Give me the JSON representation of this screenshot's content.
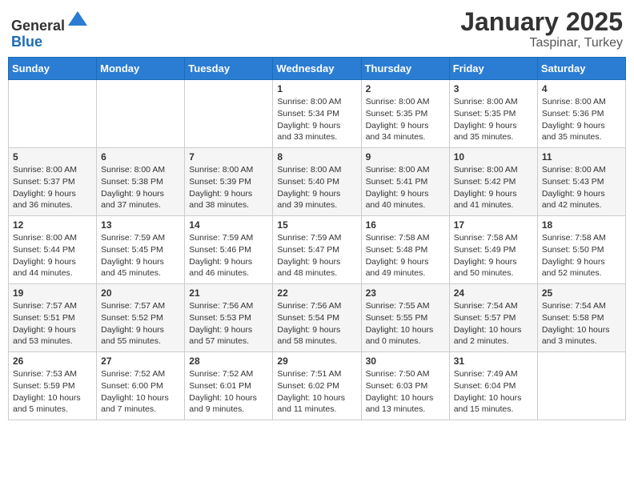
{
  "header": {
    "logo_general": "General",
    "logo_blue": "Blue",
    "month_title": "January 2025",
    "location": "Taspinar, Turkey"
  },
  "days_of_week": [
    "Sunday",
    "Monday",
    "Tuesday",
    "Wednesday",
    "Thursday",
    "Friday",
    "Saturday"
  ],
  "weeks": [
    [
      {
        "day": "",
        "info": ""
      },
      {
        "day": "",
        "info": ""
      },
      {
        "day": "",
        "info": ""
      },
      {
        "day": "1",
        "info": "Sunrise: 8:00 AM\nSunset: 5:34 PM\nDaylight: 9 hours\nand 33 minutes."
      },
      {
        "day": "2",
        "info": "Sunrise: 8:00 AM\nSunset: 5:35 PM\nDaylight: 9 hours\nand 34 minutes."
      },
      {
        "day": "3",
        "info": "Sunrise: 8:00 AM\nSunset: 5:35 PM\nDaylight: 9 hours\nand 35 minutes."
      },
      {
        "day": "4",
        "info": "Sunrise: 8:00 AM\nSunset: 5:36 PM\nDaylight: 9 hours\nand 35 minutes."
      }
    ],
    [
      {
        "day": "5",
        "info": "Sunrise: 8:00 AM\nSunset: 5:37 PM\nDaylight: 9 hours\nand 36 minutes."
      },
      {
        "day": "6",
        "info": "Sunrise: 8:00 AM\nSunset: 5:38 PM\nDaylight: 9 hours\nand 37 minutes."
      },
      {
        "day": "7",
        "info": "Sunrise: 8:00 AM\nSunset: 5:39 PM\nDaylight: 9 hours\nand 38 minutes."
      },
      {
        "day": "8",
        "info": "Sunrise: 8:00 AM\nSunset: 5:40 PM\nDaylight: 9 hours\nand 39 minutes."
      },
      {
        "day": "9",
        "info": "Sunrise: 8:00 AM\nSunset: 5:41 PM\nDaylight: 9 hours\nand 40 minutes."
      },
      {
        "day": "10",
        "info": "Sunrise: 8:00 AM\nSunset: 5:42 PM\nDaylight: 9 hours\nand 41 minutes."
      },
      {
        "day": "11",
        "info": "Sunrise: 8:00 AM\nSunset: 5:43 PM\nDaylight: 9 hours\nand 42 minutes."
      }
    ],
    [
      {
        "day": "12",
        "info": "Sunrise: 8:00 AM\nSunset: 5:44 PM\nDaylight: 9 hours\nand 44 minutes."
      },
      {
        "day": "13",
        "info": "Sunrise: 7:59 AM\nSunset: 5:45 PM\nDaylight: 9 hours\nand 45 minutes."
      },
      {
        "day": "14",
        "info": "Sunrise: 7:59 AM\nSunset: 5:46 PM\nDaylight: 9 hours\nand 46 minutes."
      },
      {
        "day": "15",
        "info": "Sunrise: 7:59 AM\nSunset: 5:47 PM\nDaylight: 9 hours\nand 48 minutes."
      },
      {
        "day": "16",
        "info": "Sunrise: 7:58 AM\nSunset: 5:48 PM\nDaylight: 9 hours\nand 49 minutes."
      },
      {
        "day": "17",
        "info": "Sunrise: 7:58 AM\nSunset: 5:49 PM\nDaylight: 9 hours\nand 50 minutes."
      },
      {
        "day": "18",
        "info": "Sunrise: 7:58 AM\nSunset: 5:50 PM\nDaylight: 9 hours\nand 52 minutes."
      }
    ],
    [
      {
        "day": "19",
        "info": "Sunrise: 7:57 AM\nSunset: 5:51 PM\nDaylight: 9 hours\nand 53 minutes."
      },
      {
        "day": "20",
        "info": "Sunrise: 7:57 AM\nSunset: 5:52 PM\nDaylight: 9 hours\nand 55 minutes."
      },
      {
        "day": "21",
        "info": "Sunrise: 7:56 AM\nSunset: 5:53 PM\nDaylight: 9 hours\nand 57 minutes."
      },
      {
        "day": "22",
        "info": "Sunrise: 7:56 AM\nSunset: 5:54 PM\nDaylight: 9 hours\nand 58 minutes."
      },
      {
        "day": "23",
        "info": "Sunrise: 7:55 AM\nSunset: 5:55 PM\nDaylight: 10 hours\nand 0 minutes."
      },
      {
        "day": "24",
        "info": "Sunrise: 7:54 AM\nSunset: 5:57 PM\nDaylight: 10 hours\nand 2 minutes."
      },
      {
        "day": "25",
        "info": "Sunrise: 7:54 AM\nSunset: 5:58 PM\nDaylight: 10 hours\nand 3 minutes."
      }
    ],
    [
      {
        "day": "26",
        "info": "Sunrise: 7:53 AM\nSunset: 5:59 PM\nDaylight: 10 hours\nand 5 minutes."
      },
      {
        "day": "27",
        "info": "Sunrise: 7:52 AM\nSunset: 6:00 PM\nDaylight: 10 hours\nand 7 minutes."
      },
      {
        "day": "28",
        "info": "Sunrise: 7:52 AM\nSunset: 6:01 PM\nDaylight: 10 hours\nand 9 minutes."
      },
      {
        "day": "29",
        "info": "Sunrise: 7:51 AM\nSunset: 6:02 PM\nDaylight: 10 hours\nand 11 minutes."
      },
      {
        "day": "30",
        "info": "Sunrise: 7:50 AM\nSunset: 6:03 PM\nDaylight: 10 hours\nand 13 minutes."
      },
      {
        "day": "31",
        "info": "Sunrise: 7:49 AM\nSunset: 6:04 PM\nDaylight: 10 hours\nand 15 minutes."
      },
      {
        "day": "",
        "info": ""
      }
    ]
  ]
}
